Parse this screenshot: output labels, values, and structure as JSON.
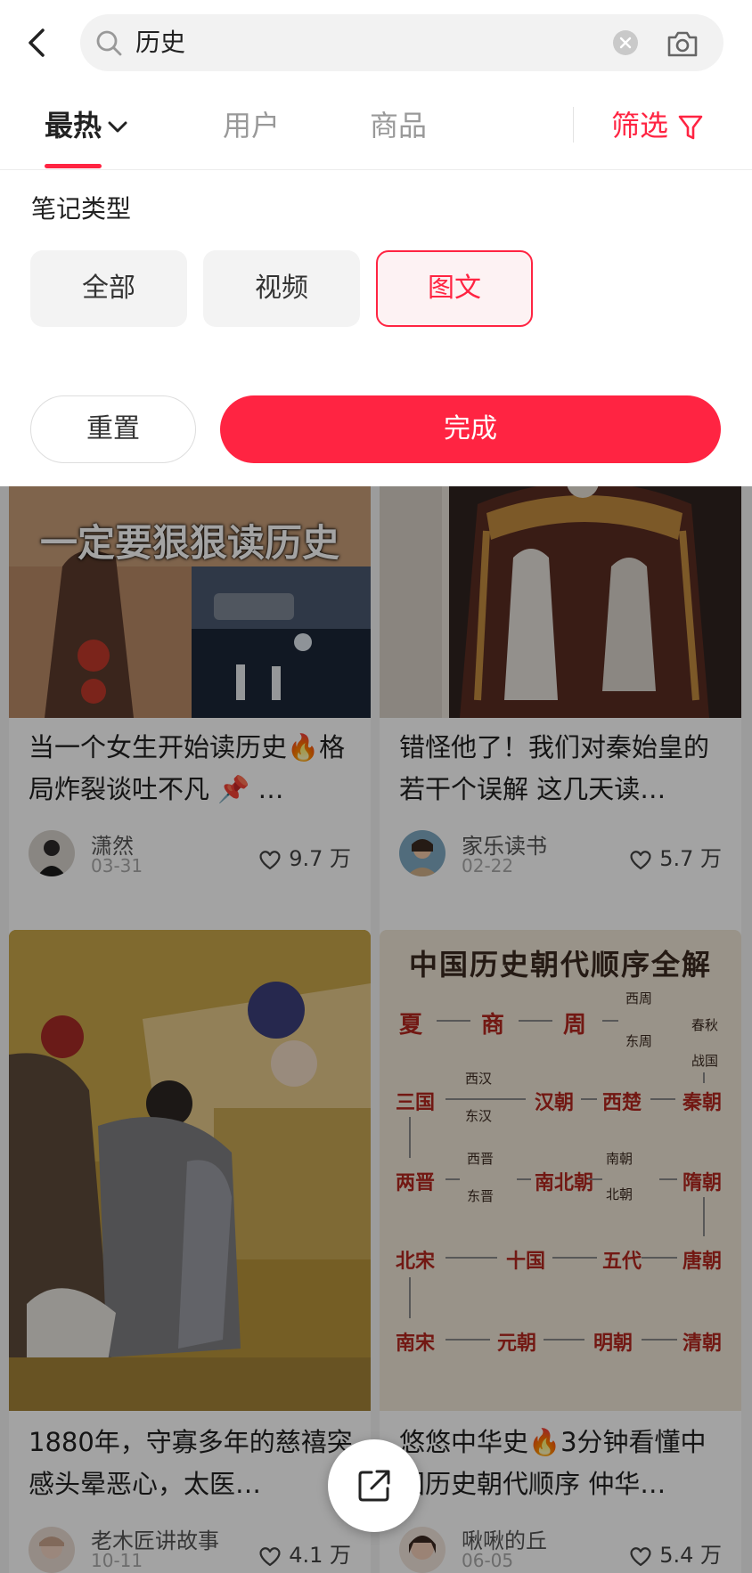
{
  "search": {
    "query": "历史",
    "accent": "#ff2442"
  },
  "tabs": {
    "hot": "最热",
    "users": "用户",
    "goods": "商品",
    "filter": "筛选"
  },
  "panel": {
    "title": "笔记类型",
    "chips": [
      "全部",
      "视频",
      "图文"
    ],
    "selected_chip": "图文",
    "reset": "重置",
    "done": "完成"
  },
  "feed": {
    "banner_text": "一定要狠狠读历史",
    "cards": [
      {
        "title": "当一个女生开始读历史🔥格局炸裂谈吐不凡 📌 …",
        "author": "潇然",
        "date": "03-31",
        "likes": "9.7 万"
      },
      {
        "title": "错怪他了！我们对秦始皇的若干个误解 这几天读…",
        "author": "家乐读书",
        "date": "02-22",
        "likes": "5.7 万"
      },
      {
        "title": "1880年，守寡多年的慈禧突感头晕恶心，太医…",
        "author": "老木匠讲故事",
        "date": "10-11",
        "likes": "4.1 万"
      },
      {
        "title": "悠悠中华史🔥3分钟看懂中国历史朝代顺序 仲华…",
        "author": "啾啾的丘",
        "date": "06-05",
        "likes": "5.4 万"
      }
    ],
    "dynasty_chart": {
      "title": "中国历史朝代顺序全解",
      "dynasties": [
        "夏",
        "商",
        "周",
        "西周",
        "东周",
        "春秋",
        "战国",
        "秦朝",
        "西楚",
        "汉朝",
        "西汉",
        "东汉",
        "三国",
        "两晋",
        "西晋",
        "东晋",
        "南北朝",
        "南朝",
        "北朝",
        "隋朝",
        "唐朝",
        "五代",
        "十国",
        "北宋",
        "南宋",
        "元朝",
        "明朝",
        "清朝"
      ]
    }
  }
}
